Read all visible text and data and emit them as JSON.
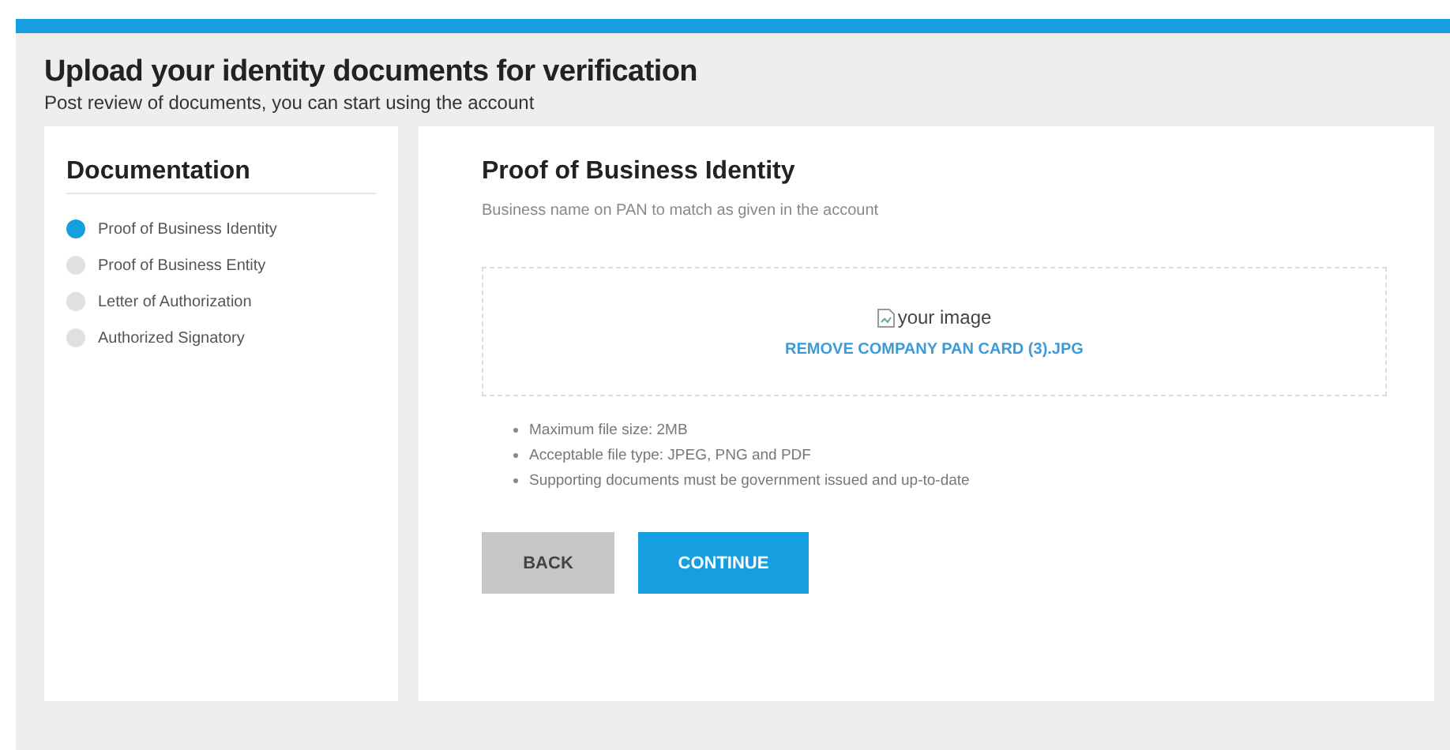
{
  "header": {
    "title": "Upload your identity documents for verification",
    "subtitle": "Post review of documents, you can start using the account"
  },
  "sidebar": {
    "title": "Documentation",
    "steps": [
      {
        "label": "Proof of Business Identity",
        "selected": true
      },
      {
        "label": "Proof of Business Entity",
        "selected": false
      },
      {
        "label": "Letter of Authorization",
        "selected": false
      },
      {
        "label": "Authorized Signatory",
        "selected": false
      }
    ]
  },
  "panel": {
    "title": "Proof of Business Identity",
    "description": "Business name on PAN to match as given in the account",
    "upload": {
      "image_alt": "your image",
      "remove_link": "REMOVE COMPANY PAN CARD (3).JPG"
    },
    "requirements": [
      "Maximum file size: 2MB",
      "Acceptable file type: JPEG, PNG and PDF",
      "Supporting documents must be government issued and up-to-date"
    ],
    "buttons": [
      {
        "label": "BACK",
        "kind": "secondary"
      },
      {
        "label": "CONTINUE",
        "kind": "primary"
      }
    ]
  }
}
